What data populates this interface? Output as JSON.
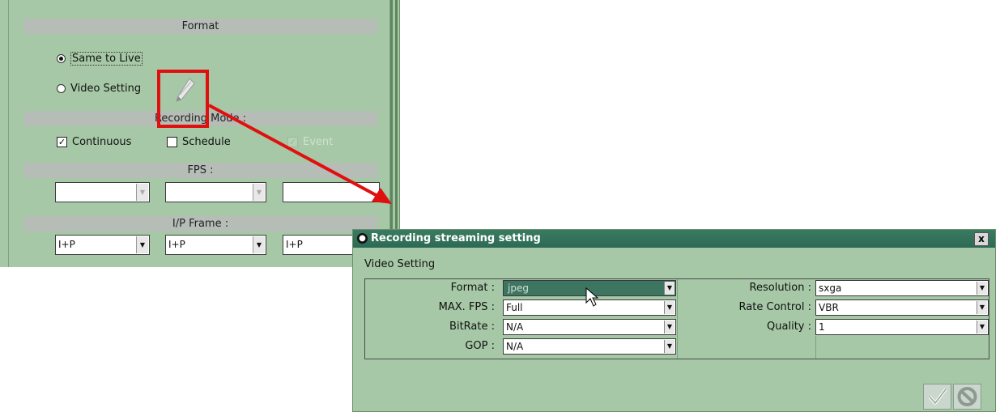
{
  "background": {
    "format_header": "Format",
    "same_to_live": "Same to Live",
    "video_setting": "Video Setting",
    "recording_mode_header": "Recording Mode :",
    "continuous": "Continuous",
    "schedule": "Schedule",
    "event": "Event",
    "fps_header": "FPS :",
    "ip_frame_header": "I/P Frame :",
    "ip_values": [
      "I+P",
      "I+P",
      "I+P"
    ]
  },
  "dialog": {
    "title": "Recording streaming setting",
    "close_label": "x",
    "section_label": "Video Setting",
    "left_fields": [
      {
        "label": "Format :",
        "value": "jpeg"
      },
      {
        "label": "MAX. FPS :",
        "value": "Full"
      },
      {
        "label": "BitRate :",
        "value": "N/A"
      },
      {
        "label": "GOP :",
        "value": "N/A"
      }
    ],
    "right_fields": [
      {
        "label": "Resolution :",
        "value": "sxga"
      },
      {
        "label": "Rate Control :",
        "value": "VBR"
      },
      {
        "label": "Quality :",
        "value": "1"
      }
    ]
  },
  "icons": {
    "pencil": "pencil-icon",
    "ok": "check-icon",
    "cancel": "cancel-icon",
    "cursor": "cursor-icon"
  },
  "colors": {
    "panel": "#a6c8a6",
    "titlebar": "#2d6a54",
    "highlight": "#e01010"
  }
}
